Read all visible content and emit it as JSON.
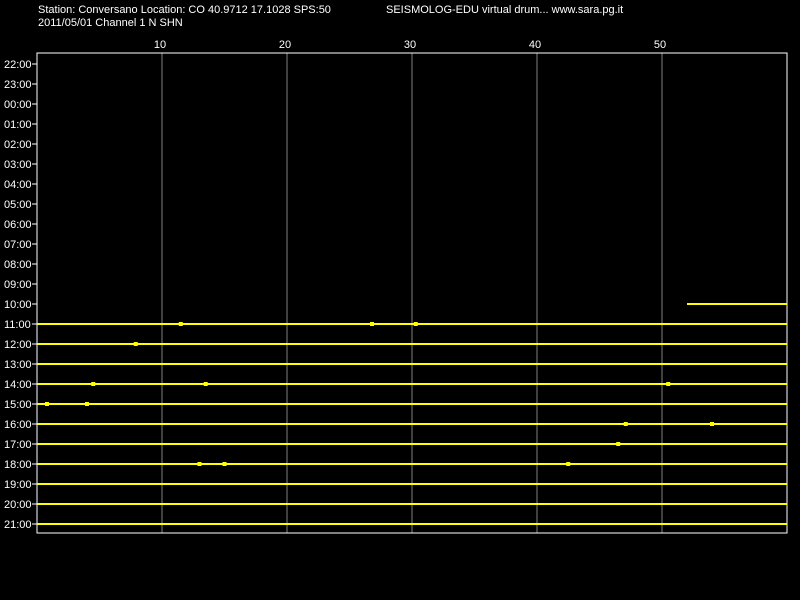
{
  "header": {
    "station_line": "Station: Conversano Location: CO 40.9712 17.1028 SPS:50",
    "title": "SEISMOLOG-EDU virtual drum... www.sara.pg.it",
    "date_channel": "2011/05/01  Channel 1 N SHN"
  },
  "chart_data": {
    "type": "line",
    "title": "SEISMOLOG-EDU virtual drum... www.sara.pg.it",
    "xlabel": "",
    "ylabel": "",
    "xlim": [
      0,
      60
    ],
    "x_ticks": [
      10,
      20,
      30,
      40,
      50
    ],
    "x_tick_labels": [
      "10",
      "20",
      "30",
      "40",
      "50"
    ],
    "rows": [
      "22:00",
      "23:00",
      "00:00",
      "01:00",
      "02:00",
      "03:00",
      "04:00",
      "05:00",
      "06:00",
      "07:00",
      "08:00",
      "09:00",
      "10:00",
      "11:00",
      "12:00",
      "13:00",
      "14:00",
      "15:00",
      "16:00",
      "17:00",
      "18:00",
      "19:00",
      "20:00",
      "21:00"
    ],
    "traces": [
      {
        "row": "10:00",
        "start_min": 52,
        "end_min": 60
      },
      {
        "row": "11:00",
        "start_min": 0,
        "end_min": 60
      },
      {
        "row": "12:00",
        "start_min": 0,
        "end_min": 60
      },
      {
        "row": "13:00",
        "start_min": 0,
        "end_min": 60
      },
      {
        "row": "14:00",
        "start_min": 0,
        "end_min": 60
      },
      {
        "row": "15:00",
        "start_min": 0,
        "end_min": 60
      },
      {
        "row": "16:00",
        "start_min": 0,
        "end_min": 60
      },
      {
        "row": "17:00",
        "start_min": 0,
        "end_min": 60
      },
      {
        "row": "18:00",
        "start_min": 0,
        "end_min": 60
      },
      {
        "row": "19:00",
        "start_min": 0,
        "end_min": 60
      },
      {
        "row": "20:00",
        "start_min": 0,
        "end_min": 60
      },
      {
        "row": "21:00",
        "start_min": 0,
        "end_min": 60
      }
    ],
    "events": [
      {
        "row": "11:00",
        "minute": 11.5
      },
      {
        "row": "11:00",
        "minute": 26.8
      },
      {
        "row": "11:00",
        "minute": 30.3
      },
      {
        "row": "12:00",
        "minute": 7.9
      },
      {
        "row": "14:00",
        "minute": 4.5
      },
      {
        "row": "14:00",
        "minute": 13.5
      },
      {
        "row": "14:00",
        "minute": 50.5
      },
      {
        "row": "15:00",
        "minute": 0.8
      },
      {
        "row": "15:00",
        "minute": 4.0
      },
      {
        "row": "16:00",
        "minute": 47.1
      },
      {
        "row": "16:00",
        "minute": 54.0
      },
      {
        "row": "17:00",
        "minute": 46.5
      },
      {
        "row": "18:00",
        "minute": 13.0
      },
      {
        "row": "18:00",
        "minute": 15.0
      },
      {
        "row": "18:00",
        "minute": 42.5
      }
    ],
    "grid": true,
    "colors": {
      "background": "#000000",
      "plot_border": "#ffffff",
      "grid": "#808080",
      "trace": "#ffff00",
      "text": "#ffffff"
    }
  }
}
